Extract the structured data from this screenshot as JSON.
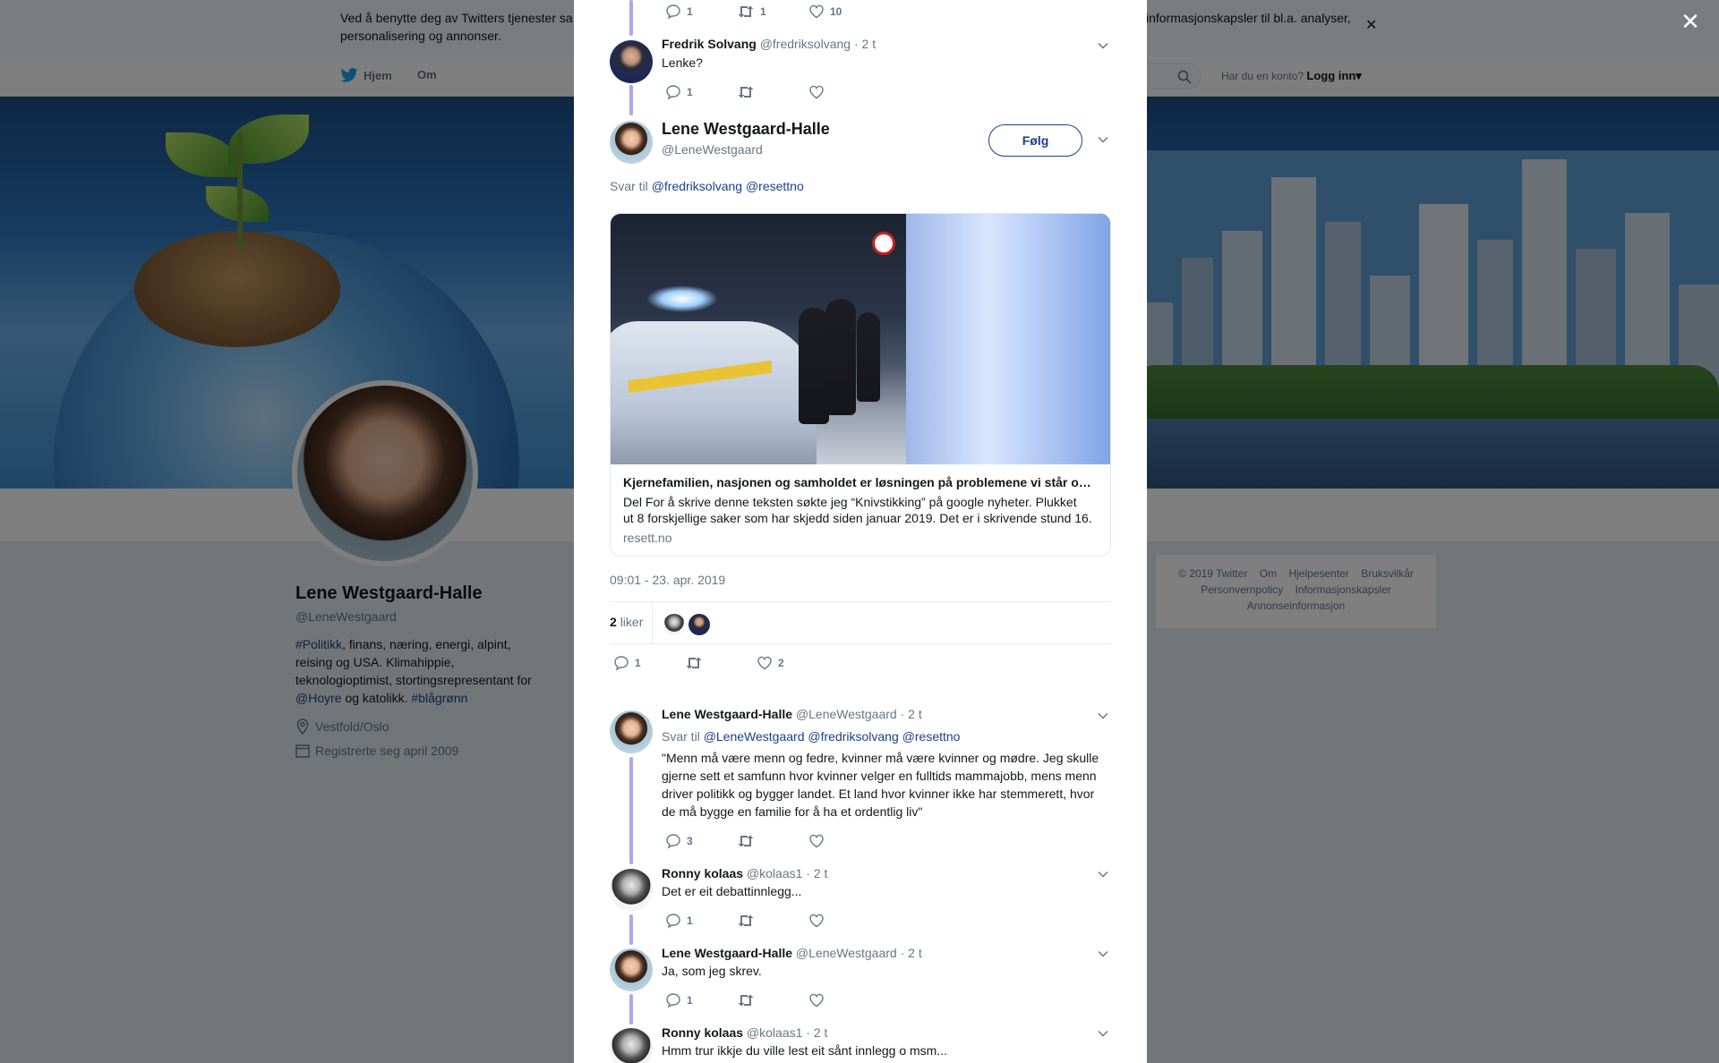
{
  "background": {
    "cookie_text": "Ved å benytte deg av Twitters tjenester sa… informasjonskapsler til bl.a. analyser, personalisering og annonser.",
    "cookie_text_left": "Ved å benytte deg av Twitters tjenester sa",
    "cookie_text_right": "informasjonskapsler til bl.a. analyser,",
    "cookie_text_line2": "personalisering og annonser.",
    "nav_home": "Hjem",
    "nav_about": "Om",
    "account_question": "Har du en konto?",
    "login": "Logg inn",
    "profile": {
      "name": "Lene Westgaard-Halle",
      "handle": "@LeneWestgaard",
      "bio_hashtag": "#Politikk",
      "bio_line1_rest": ", finans, næring, energi, alpint,",
      "bio_line2": "reising og USA. Klimahippie,",
      "bio_line3": "teknologioptimist, stortingsrepresentant for",
      "bio_mention": "@Hoyre",
      "bio_and": " og katolikk. ",
      "bio_hashtag2": "#blågrønn",
      "location": "Vestfold/Oslo",
      "joined": "Registrerte seg april 2009"
    },
    "footer": {
      "copyright": "© 2019 Twitter",
      "about": "Om",
      "help": "Hjelpesenter",
      "terms": "Bruksvilkår",
      "privacy": "Personvernpolicy",
      "cookies": "Informasjonskapsler",
      "ads": "Annonseinformasjon"
    }
  },
  "modal": {
    "top_actions": {
      "replies": "1",
      "retweets": "1",
      "likes": "10"
    },
    "reply1": {
      "name": "Fredrik Solvang",
      "handle": "@fredriksolvang",
      "time": "· 2 t",
      "text": "Lenke?",
      "replies": "1"
    },
    "main": {
      "name": "Lene Westgaard-Halle",
      "handle": "@LeneWestgaard",
      "follow": "Følg",
      "reply_to_prefix": "Svar til",
      "reply_to_1": "@fredriksolvang",
      "reply_to_2": "@resettno",
      "card_title": "Kjernefamilien, nasjonen og samholdet er løsningen på problemene vi står o…",
      "card_desc_line1": "Del For å skrive denne teksten søkte jeg “Knivstikking” på google nyheter. Plukket",
      "card_desc_line2": "ut 8 forskjellige saker som har skjedd siden januar 2019. Det er i skrivende stund 16.",
      "card_domain": "resett.no",
      "timestamp": "09:01 - 23. apr. 2019",
      "likes_count": "2",
      "likes_label": "liker",
      "replies": "1",
      "likes": "2"
    },
    "reply2": {
      "name": "Lene Westgaard-Halle",
      "handle": "@LeneWestgaard",
      "time": "· 2 t",
      "reply_to_prefix": "Svar til",
      "reply_to_1": "@LeneWestgaard",
      "reply_to_2": "@fredriksolvang",
      "reply_to_3": "@resettno",
      "text_line1": "\"Menn må være menn og fedre, kvinner må være kvinner og mødre. Jeg skulle",
      "text_line2": "gjerne sett et samfunn hvor kvinner velger en fulltids mammajobb, mens menn",
      "text_line3": "driver politikk og bygger landet. Et land hvor kvinner ikke har stemmerett, hvor",
      "text_line4": "de må bygge en familie for å ha et ordentlig liv\"",
      "replies": "3"
    },
    "reply3": {
      "name": "Ronny kolaas",
      "handle": "@kolaas1",
      "time": "· 2 t",
      "text": "Det er eit debattinnlegg...",
      "replies": "1"
    },
    "reply4": {
      "name": "Lene Westgaard-Halle",
      "handle": "@LeneWestgaard",
      "time": "· 2 t",
      "text": "Ja, som jeg skrev.",
      "replies": "1"
    },
    "reply5": {
      "name": "Ronny kolaas",
      "handle": "@kolaas1",
      "time": "· 2 t",
      "text": "Hmm trur ikkje du ville lest eit sånt innlegg o msm..."
    }
  },
  "colors": {
    "link": "#1b3f8f",
    "thread_line": "#a9a9e8",
    "muted": "#657786"
  },
  "icons": [
    "reply-icon",
    "retweet-icon",
    "like-icon",
    "chevron-down-icon",
    "close-icon",
    "search-icon",
    "twitter-bird-icon",
    "location-icon",
    "calendar-icon"
  ]
}
